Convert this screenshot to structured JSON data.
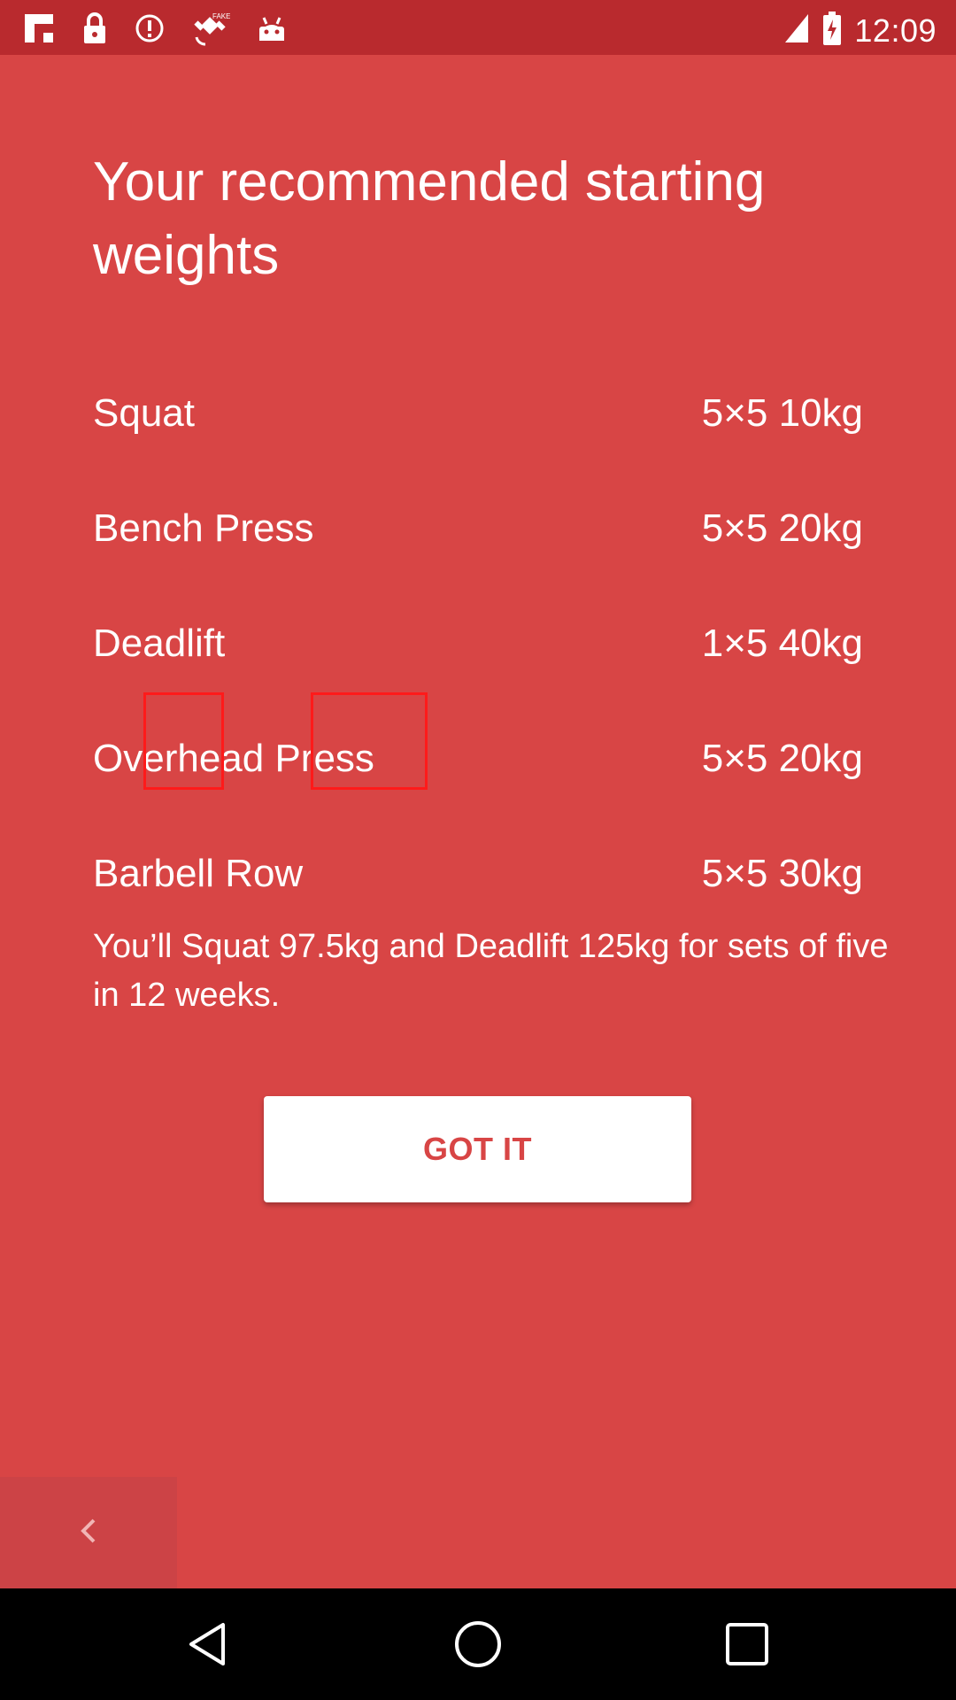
{
  "status_bar": {
    "time": "12:09",
    "left_icons": [
      "flipboard-icon",
      "lock-icon",
      "alert-icon",
      "fake-gps-icon",
      "android-icon"
    ],
    "right_icons": [
      "signal-icon",
      "battery-icon"
    ]
  },
  "screen": {
    "title": "Your recommended starting weights",
    "exercises": [
      {
        "name": "Squat",
        "value": "5×5 10kg"
      },
      {
        "name": "Bench Press",
        "value": "5×5 20kg"
      },
      {
        "name": "Deadlift",
        "value": "1×5 40kg"
      },
      {
        "name": "Overhead Press",
        "value": "5×5 20kg"
      },
      {
        "name": "Barbell Row",
        "value": "5×5 30kg"
      }
    ],
    "summary": "You’ll Squat 97.5kg and Deadlift 125kg for sets of five in 12 weeks.",
    "got_it_label": "GOT IT"
  },
  "colors": {
    "background": "#d84545",
    "status_bar": "#b92a2e",
    "button_text": "#d84545",
    "highlight": "#ff1a1a"
  }
}
